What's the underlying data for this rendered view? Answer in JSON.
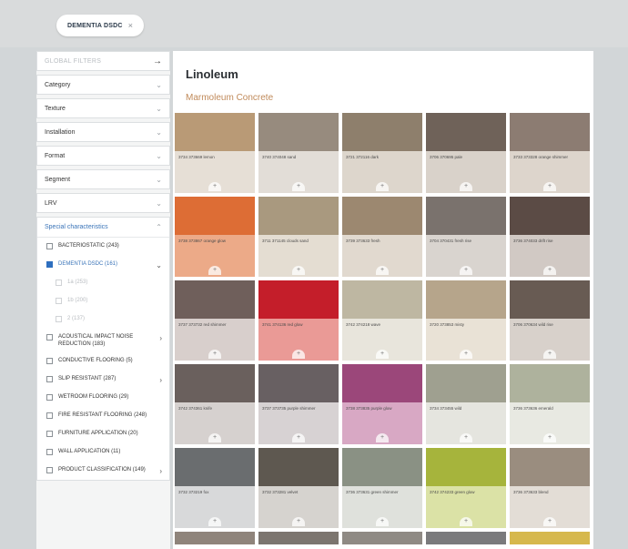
{
  "filter_chip": {
    "label": "DEMENTIA DSDC",
    "close": "×"
  },
  "sidebar": {
    "global_filters": {
      "label": "GLOBAL FILTERS",
      "arrow": "→"
    },
    "panels": [
      {
        "label": "Category",
        "chevron": "⌄"
      },
      {
        "label": "Texture",
        "chevron": "⌄"
      },
      {
        "label": "Installation",
        "chevron": "⌄"
      },
      {
        "label": "Format",
        "chevron": "⌄"
      },
      {
        "label": "Segment",
        "chevron": "⌄"
      },
      {
        "label": "LRV",
        "chevron": "⌄"
      }
    ],
    "special": {
      "label": "Special characteristics",
      "chevron": "⌃",
      "options": [
        {
          "label": "BACTERIOSTATIC (243)",
          "checked": false,
          "style": "normal",
          "arrow": ""
        },
        {
          "label": "DEMENTIA DSDC (161)",
          "checked": true,
          "style": "blue",
          "arrow": "⌄"
        },
        {
          "label": "1a (253)",
          "checked": false,
          "style": "faint",
          "arrow": "",
          "sub": true
        },
        {
          "label": "1b (200)",
          "checked": false,
          "style": "faint",
          "arrow": "",
          "sub": true
        },
        {
          "label": "2 (137)",
          "checked": false,
          "style": "faint",
          "arrow": "",
          "sub": true
        },
        {
          "label": "ACOUSTICAL IMPACT NOISE REDUCTION (183)",
          "checked": false,
          "style": "normal",
          "arrow": "›"
        },
        {
          "label": "CONDUCTIVE FLOORING (5)",
          "checked": false,
          "style": "normal",
          "arrow": ""
        },
        {
          "label": "SLIP RESISTANT (287)",
          "checked": false,
          "style": "normal",
          "arrow": "›"
        },
        {
          "label": "WETROOM FLOORING (29)",
          "checked": false,
          "style": "normal",
          "arrow": ""
        },
        {
          "label": "FIRE RESISTANT FLOORING (248)",
          "checked": false,
          "style": "normal",
          "arrow": ""
        },
        {
          "label": "FURNITURE APPLICATION (20)",
          "checked": false,
          "style": "normal",
          "arrow": ""
        },
        {
          "label": "WALL APPLICATION (11)",
          "checked": false,
          "style": "normal",
          "arrow": ""
        },
        {
          "label": "PRODUCT CLASSIFICATION (149)",
          "checked": false,
          "style": "normal",
          "arrow": "›"
        }
      ]
    }
  },
  "main": {
    "title": "Linoleum",
    "subtitle": "Marmoleum Concrete",
    "tiles": [
      {
        "name": "3734 373669 lemon",
        "top": "#b99a76",
        "bottom": "#e6dfd6"
      },
      {
        "name": "3740 374048 sand",
        "top": "#978b7e",
        "bottom": "#e2ddd7"
      },
      {
        "name": "3721 372116 dark",
        "top": "#8e7f6c",
        "bottom": "#ddd6cc"
      },
      {
        "name": "3706 370695 pale",
        "top": "#6f6259",
        "bottom": "#d9d2ca"
      },
      {
        "name": "3733 373328 orange shimmer",
        "top": "#8c7c72",
        "bottom": "#ddd5cc"
      },
      {
        "name": "3738 373867 orange glow",
        "top": "#dd6d35",
        "bottom": "#ecaa88"
      },
      {
        "name": "3711 371145 clouds sand",
        "top": "#a9997f",
        "bottom": "#e4ddd2"
      },
      {
        "name": "3739 373633 fresh",
        "top": "#9c8870",
        "bottom": "#e1d9cf"
      },
      {
        "name": "3704 370431 fresh rise",
        "top": "#7a726d",
        "bottom": "#d9d4cf"
      },
      {
        "name": "3736 374033 drift rise",
        "top": "#5b4b45",
        "bottom": "#d1c9c4"
      },
      {
        "name": "3737 373732 red shimmer",
        "top": "#6f5f5b",
        "bottom": "#d8cfcc"
      },
      {
        "name": "3741 374136 red glow",
        "top": "#c41e2a",
        "bottom": "#ea9a96"
      },
      {
        "name": "3742 374218 wave",
        "top": "#beb7a2",
        "bottom": "#e8e5dc"
      },
      {
        "name": "3720 373853 misty",
        "top": "#b6a58b",
        "bottom": "#e9e2d6"
      },
      {
        "name": "3706 370634 wild rise",
        "top": "#685b53",
        "bottom": "#d8d1cb"
      },
      {
        "name": "3742 374361 knife",
        "top": "#6a605d",
        "bottom": "#d6d1cf"
      },
      {
        "name": "3737 373735 purple shimmer",
        "top": "#686062",
        "bottom": "#d7d2d3"
      },
      {
        "name": "3738 373835 purple glow",
        "top": "#9b477a",
        "bottom": "#d8a8c4"
      },
      {
        "name": "3734 373455 wild",
        "top": "#9fa090",
        "bottom": "#e5e5df"
      },
      {
        "name": "3736 373636 emerald",
        "top": "#aeb29d",
        "bottom": "#e8e9e2"
      },
      {
        "name": "3732 373219 fox",
        "top": "#6a6d6f",
        "bottom": "#d8d9da"
      },
      {
        "name": "3732 373281 velvet",
        "top": "#5e5850",
        "bottom": "#d6d3cf"
      },
      {
        "name": "3736 373631 green shimmer",
        "top": "#8a9184",
        "bottom": "#dfe1dc"
      },
      {
        "name": "3742 374233 green glow",
        "top": "#a6b43c",
        "bottom": "#dbe2a6"
      },
      {
        "name": "3736 373633 blend",
        "top": "#9a8d7f",
        "bottom": "#e3ddd6"
      },
      {
        "name": "",
        "top": "#8f847b",
        "bottom": "#8f847b"
      },
      {
        "name": "",
        "top": "#7c756f",
        "bottom": "#7c756f"
      },
      {
        "name": "",
        "top": "#8f8a84",
        "bottom": "#8f8a84"
      },
      {
        "name": "",
        "top": "#7a7a7c",
        "bottom": "#7a7a7c"
      },
      {
        "name": "",
        "top": "#d6b84d",
        "bottom": "#d6b84d"
      }
    ]
  }
}
